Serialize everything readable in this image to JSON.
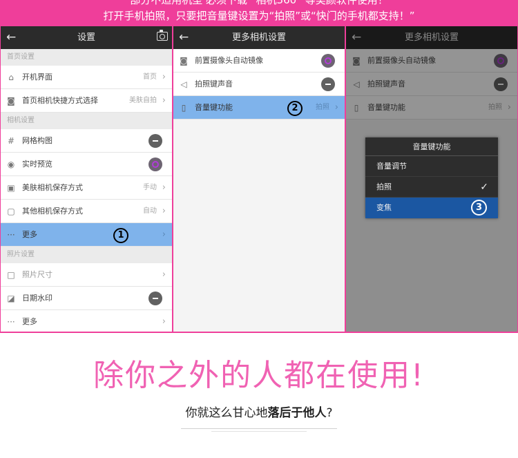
{
  "banner": {
    "line1": "部分不适用机型 必须下载 “相机360” 等美颜软件使用！",
    "line2": "打开手机拍照，只要把音量键设置为“拍照”或“快门的手机都支持！”"
  },
  "panel1": {
    "title": "设置",
    "back_glyph": "←",
    "sections": {
      "home": "首页设置",
      "camera": "相机设置",
      "photo": "照片设置"
    },
    "rows": {
      "boot": {
        "label": "开机界面",
        "value": "首页"
      },
      "shortcut": {
        "label": "首页相机快捷方式选择",
        "value": "美肤自拍"
      },
      "grid": {
        "label": "网格构图"
      },
      "preview": {
        "label": "实时预览"
      },
      "beauty_save": {
        "label": "美肤相机保存方式",
        "value": "手动"
      },
      "other_save": {
        "label": "其他相机保存方式",
        "value": "自动"
      },
      "more": {
        "label": "更多",
        "step": "1"
      },
      "size": {
        "label": "照片尺寸"
      },
      "watermark": {
        "label": "日期水印"
      },
      "more2": {
        "label": "更多"
      }
    }
  },
  "panel2": {
    "title": "更多相机设置",
    "back_glyph": "←",
    "rows": {
      "mirror": {
        "label": "前置摄像头自动镜像"
      },
      "shutter_sound": {
        "label": "拍照键声音"
      },
      "volume_key": {
        "label": "音量键功能",
        "value": "拍照",
        "step": "2"
      }
    }
  },
  "panel3": {
    "title": "更多相机设置",
    "back_glyph": "←",
    "rows": {
      "mirror": {
        "label": "前置摄像头自动镜像"
      },
      "shutter_sound": {
        "label": "拍照键声音"
      },
      "volume_key": {
        "label": "音量键功能",
        "value": "拍照"
      }
    },
    "dialog": {
      "title": "音量键功能",
      "options": [
        "音量调节",
        "拍照",
        "变焦"
      ],
      "checked": "拍照",
      "step": "3"
    }
  },
  "slogan": "除你之外的人都在使用!",
  "subtitle": {
    "normal1": "你就这么甘心地",
    "bold": "落后于他人",
    "normal2": "?"
  },
  "colors": {
    "banner": "#ef3e9a",
    "selected_row": "#7fb3eb",
    "dialog_selected": "#1b57a2",
    "slogan": "#f062b3"
  }
}
